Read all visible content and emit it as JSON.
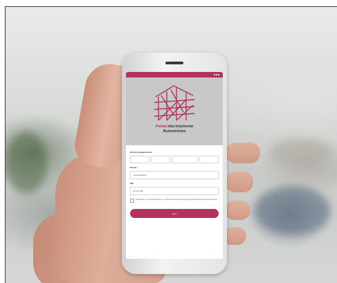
{
  "status_bar": {
    "time": "",
    "icons": [
      "signal-icon",
      "wifi-icon",
      "battery-icon"
    ]
  },
  "app": {
    "title_accent": "Polska",
    "title_line1_rest": "Izba Inżynierów",
    "title_line2": "Budownictwa",
    "brand_color": "#b3325e"
  },
  "form": {
    "type_label": "Rodzaj zawiadomienia",
    "type_options": [
      "",
      "",
      "",
      ""
    ],
    "name_label": "Nazwa",
    "name_value": "Imię Nazwisko",
    "nip_label": "NIP",
    "nip_value": "Numer NIP",
    "consent_text": "Oświadczam, że zapoznałem/am się z klauzulą informacyjną dotyczącą przetwarzania danych osobowych.",
    "submit_label": "Zgłoś"
  }
}
